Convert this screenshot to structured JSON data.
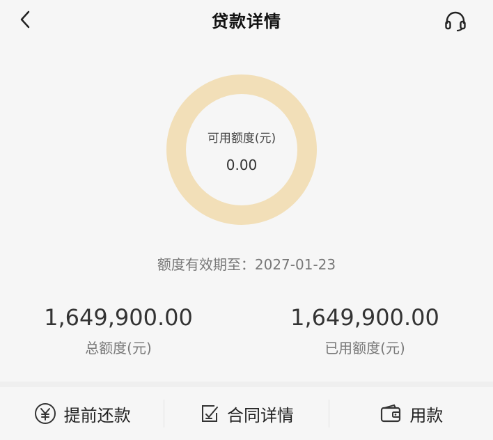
{
  "header": {
    "title": "贷款详情",
    "back_icon": "chevron-left-icon",
    "support_icon": "headset-icon"
  },
  "ring": {
    "label": "可用额度(元)",
    "value": "0.00",
    "color": "#f2dfb8"
  },
  "validity": {
    "text": "额度有效期至：2027-01-23"
  },
  "stats": {
    "total": {
      "value": "1,649,900.00",
      "label": "总额度(元)"
    },
    "used": {
      "value": "1,649,900.00",
      "label": "已用额度(元)"
    }
  },
  "actions": [
    {
      "label": "提前还款",
      "icon": "yen-circle-icon"
    },
    {
      "label": "合同详情",
      "icon": "contract-edit-icon"
    },
    {
      "label": "用款",
      "icon": "wallet-icon"
    }
  ]
}
